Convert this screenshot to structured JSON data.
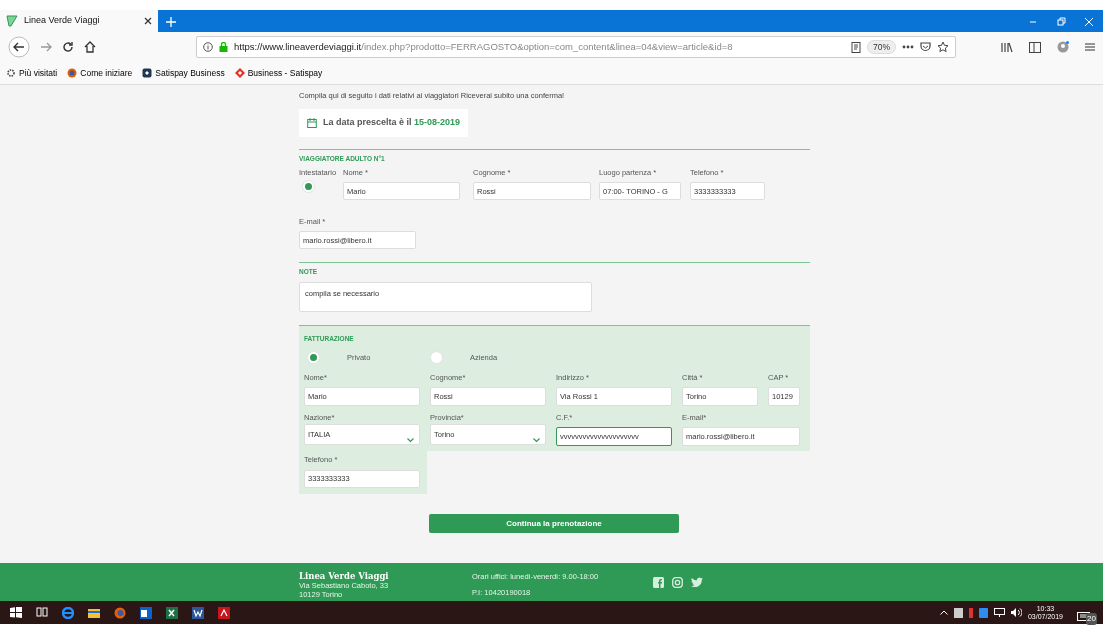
{
  "browser": {
    "tab_title": "Linea Verde Viaggi",
    "url_host": "https://www.lineaverdeviaggi.it",
    "url_path": "/index.php?prodotto=FERRAGOSTO&option=com_content&linea=04&view=article&id=8",
    "zoom": "70%",
    "bookmarks": [
      {
        "kind": "gear",
        "label": "Più visitati"
      },
      {
        "kind": "globe",
        "label": "Come iniziare"
      },
      {
        "kind": "square",
        "label": "Satispay Business"
      },
      {
        "kind": "diamond",
        "label": "Business - Satispay"
      }
    ]
  },
  "intro": "Compila qui di seguito i dati relativi ai viaggiatori Riceverai subito una conferma!",
  "date_banner": {
    "label": "La data prescelta è il",
    "date": "15-08-2019"
  },
  "traveler": {
    "title": "VIAGGIATORE ADULTO N°1",
    "holder": {
      "label": "Intestatario",
      "selected": true
    },
    "fields": [
      {
        "label": "Nome *",
        "value": "Mario"
      },
      {
        "label": "Cognome *",
        "value": "Rossi"
      },
      {
        "label": "Luogo partenza *",
        "value": "07:00- TORINO - G"
      },
      {
        "label": "Telefono *",
        "value": "3333333333"
      }
    ],
    "email": {
      "label": "E-mail *",
      "value": "mario.rossi@libero.it"
    }
  },
  "notes": {
    "title": "NOTE",
    "value": "compila se necessario"
  },
  "billing": {
    "title": "FATTURAZIONE",
    "types": [
      {
        "label": "Privato",
        "selected": true
      },
      {
        "label": "Azienda",
        "selected": false
      }
    ],
    "rows": [
      [
        {
          "kind": "text",
          "label": "Nome*",
          "value": "Mario",
          "focused": false
        },
        {
          "kind": "text",
          "label": "Cognome*",
          "value": "Rossi",
          "focused": false
        },
        {
          "kind": "text",
          "label": "Indirizzo *",
          "value": "Via Rossi 1",
          "focused": false
        },
        {
          "kind": "text",
          "label": "Città *",
          "value": "Torino",
          "focused": false
        },
        {
          "kind": "text",
          "label": "CAP *",
          "value": "10129",
          "focused": false
        }
      ],
      [
        {
          "kind": "select",
          "label": "Nazione*",
          "value": "ITALIA",
          "focused": false
        },
        {
          "kind": "select",
          "label": "Provincia*",
          "value": "Torino",
          "focused": false
        },
        {
          "kind": "text",
          "label": "C.F.*",
          "value": "vvvvvvvvvvvvvvvvvvvvv",
          "focused": true
        },
        {
          "kind": "text",
          "label": "E-mail*",
          "value": "mario.rossi@libero.it",
          "focused": false
        }
      ]
    ],
    "phone": {
      "label": "Telefono *",
      "value": "3333333333"
    }
  },
  "continue_button": "Continua la prenotazione",
  "footer": {
    "brand": "Linea Verde Viaggi",
    "address": [
      "Via Sebastiano Caboto, 33",
      "10129 Torino"
    ],
    "hours": "Orari uffici: lunedì-venerdì: 9.00-18:00",
    "vat": "P.I: 10420190018"
  },
  "taskbar": {
    "time": "10:33",
    "date": "03/07/2019",
    "notifications": "20"
  }
}
